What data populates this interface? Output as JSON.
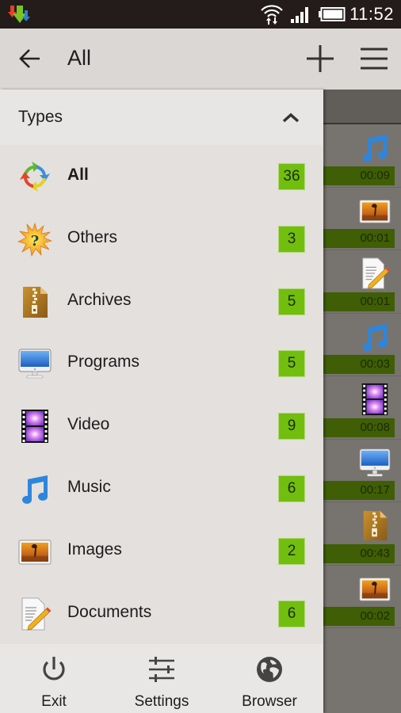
{
  "status_bar": {
    "time": "11:52",
    "icons": [
      "download-notification-icon",
      "wifi-icon",
      "signal-icon",
      "battery-icon"
    ]
  },
  "action_bar": {
    "title": "All",
    "back_icon": "arrow-left-icon",
    "add_icon": "plus-icon",
    "menu_icon": "hamburger-menu-icon"
  },
  "drawer": {
    "section_title": "Types",
    "collapse_icon": "chevron-up-icon",
    "items": [
      {
        "label": "All",
        "count": "36",
        "icon": "refresh-arrows-icon",
        "selected": true
      },
      {
        "label": "Others",
        "count": "3",
        "icon": "question-star-icon",
        "selected": false
      },
      {
        "label": "Archives",
        "count": "5",
        "icon": "zip-archive-icon",
        "selected": false
      },
      {
        "label": "Programs",
        "count": "5",
        "icon": "monitor-icon",
        "selected": false
      },
      {
        "label": "Video",
        "count": "9",
        "icon": "film-strip-icon",
        "selected": false
      },
      {
        "label": "Music",
        "count": "6",
        "icon": "music-note-icon",
        "selected": false
      },
      {
        "label": "Images",
        "count": "2",
        "icon": "image-icon",
        "selected": false
      },
      {
        "label": "Documents",
        "count": "6",
        "icon": "document-pencil-icon",
        "selected": false
      }
    ],
    "bottom_buttons": [
      {
        "label": "Exit",
        "icon": "power-icon"
      },
      {
        "label": "Settings",
        "icon": "sliders-icon"
      },
      {
        "label": "Browser",
        "icon": "globe-icon"
      }
    ]
  },
  "background_list": {
    "rows": [
      {
        "icon": "music-note-icon",
        "duration": "00:09"
      },
      {
        "icon": "image-icon",
        "duration": "00:01"
      },
      {
        "icon": "document-pencil-icon",
        "duration": "00:01"
      },
      {
        "icon": "music-note-icon",
        "duration": "00:03"
      },
      {
        "icon": "film-strip-icon",
        "duration": "00:08"
      },
      {
        "icon": "monitor-icon",
        "duration": "00:17"
      },
      {
        "icon": "zip-archive-icon",
        "duration": "00:43"
      },
      {
        "icon": "image-icon",
        "duration": "00:02"
      }
    ]
  },
  "colors": {
    "badge_green": "#71be0e",
    "duration_bar_green": "#3f5e05",
    "status_bar": "#231c1a",
    "drawer_bg": "#e3e0de"
  }
}
